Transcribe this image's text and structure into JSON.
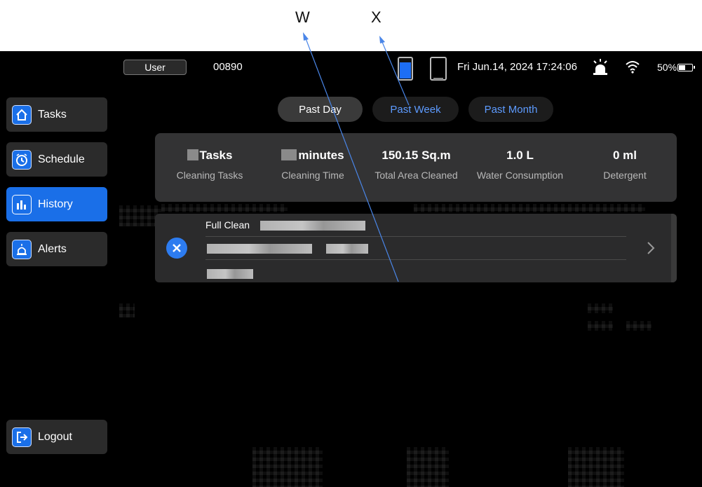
{
  "annotations": {
    "w_label": "W",
    "x_label": "X"
  },
  "status_bar": {
    "user_label": "User",
    "user_code": "00890",
    "datetime": "Fri Jun.14, 2024 17:24:06",
    "battery": "50%",
    "battery_level": 0.5,
    "clean_tank_level": 0.78
  },
  "sidebar": {
    "items": [
      {
        "label": "Tasks",
        "icon": "home-icon"
      },
      {
        "label": "Schedule",
        "icon": "clock-icon"
      },
      {
        "label": "History",
        "icon": "bar-chart-icon"
      },
      {
        "label": "Alerts",
        "icon": "alarm-icon"
      }
    ],
    "logout_label": "Logout",
    "active": "History"
  },
  "tabs": [
    {
      "label": "Past Day",
      "selected": true
    },
    {
      "label": "Past Week",
      "selected": false
    },
    {
      "label": "Past Month",
      "selected": false
    }
  ],
  "summary": {
    "stats": [
      {
        "value": "Tasks",
        "label": "Cleaning Tasks"
      },
      {
        "value": "minutes",
        "label": "Cleaning Time"
      },
      {
        "value": "150.15 Sq.m",
        "label": "Total Area Cleaned"
      },
      {
        "value": "1.0 L",
        "label": "Water Consumption"
      },
      {
        "value": "0 ml",
        "label": "Detergent"
      }
    ]
  },
  "record": {
    "title": "Full Clean",
    "status_icon": "close-icon"
  },
  "colors": {
    "accent": "#1a6fe8",
    "tab_inactive_text": "#5d9bff",
    "card": "#333334"
  }
}
